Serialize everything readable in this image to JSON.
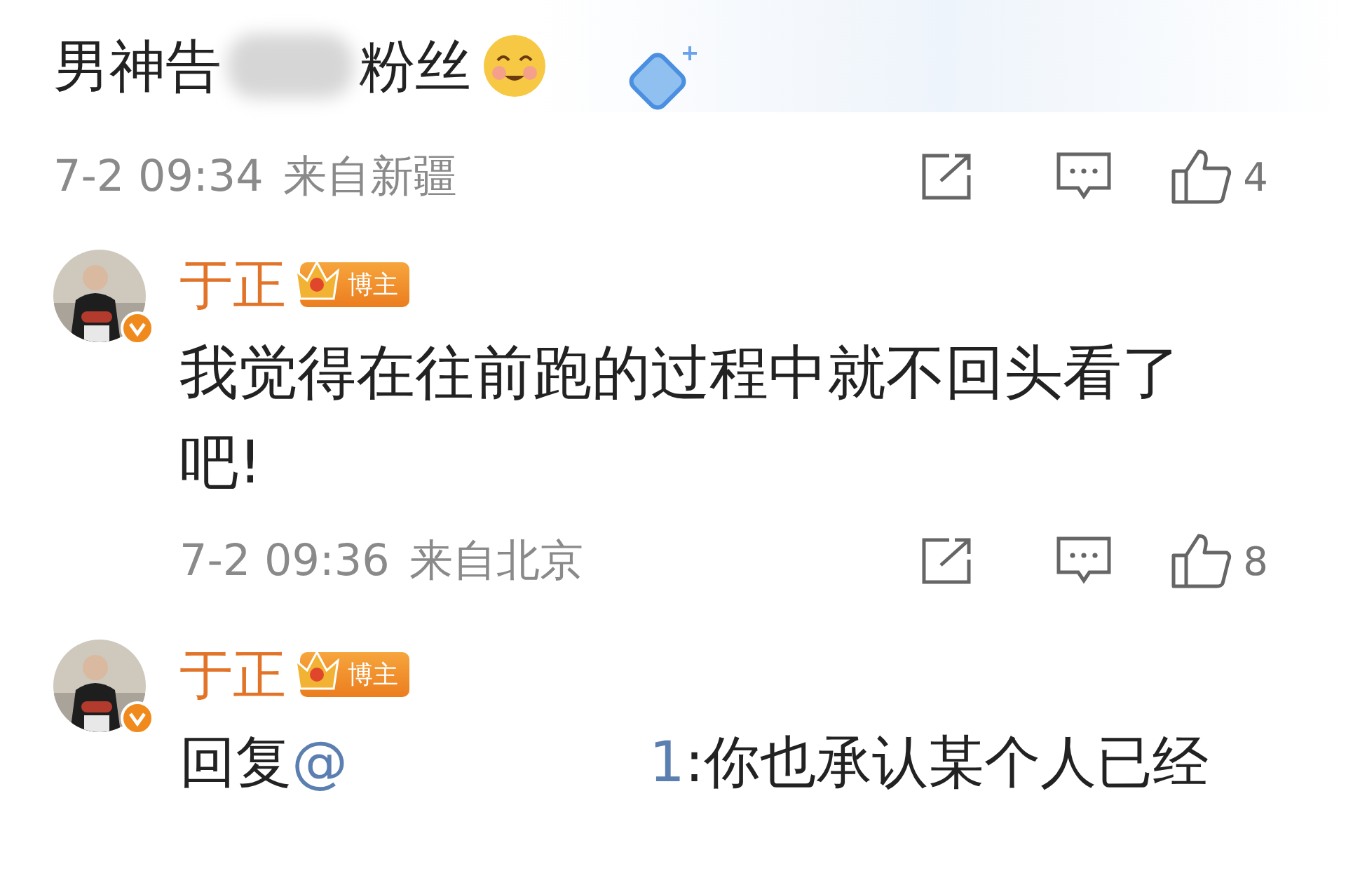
{
  "post": {
    "text_before": "男神告",
    "text_after": "粉丝",
    "time": "7-2 09:34",
    "location": "来自新疆",
    "likes": "4"
  },
  "comments": [
    {
      "kind": "plain",
      "author": "于正",
      "badge": "博主",
      "verified": true,
      "text": "我觉得在往前跑的过程中就不回头看了吧!",
      "time": "7-2 09:36",
      "location": "来自北京",
      "likes": "8"
    },
    {
      "kind": "reply",
      "author": "于正",
      "badge": "博主",
      "verified": true,
      "reply_label": "回复",
      "mention": "@",
      "mention_tail": "1",
      "text": ":你也承认某个人已经"
    }
  ]
}
